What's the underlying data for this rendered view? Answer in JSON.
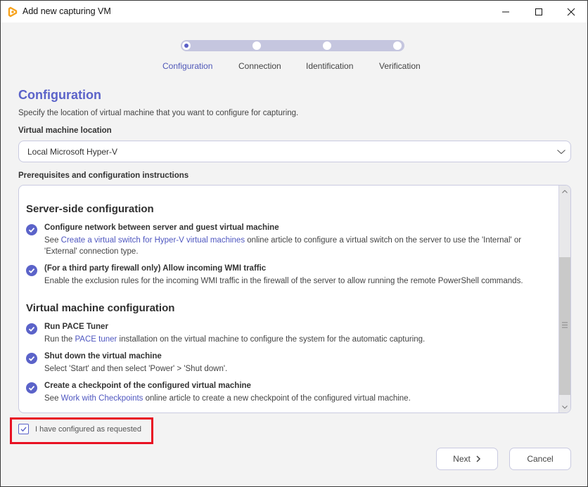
{
  "window": {
    "title": "Add new capturing VM",
    "controls": [
      "minimize",
      "maximize",
      "close"
    ]
  },
  "stepper": {
    "steps": [
      {
        "label": "Configuration",
        "active": true
      },
      {
        "label": "Connection",
        "active": false
      },
      {
        "label": "Identification",
        "active": false
      },
      {
        "label": "Verification",
        "active": false
      }
    ]
  },
  "page": {
    "title": "Configuration",
    "subtitle": "Specify the location of virtual machine that you want to configure for capturing."
  },
  "vm_location": {
    "label": "Virtual machine location",
    "selected": "Local Microsoft Hyper-V"
  },
  "instructions": {
    "label": "Prerequisites and configuration instructions",
    "sections": [
      {
        "title": "Server-side configuration",
        "items": [
          {
            "title": "Configure network between server and guest virtual machine",
            "desc_before": "See ",
            "link": "Create a virtual switch for Hyper-V virtual machines",
            "desc_after": " online article to configure a virtual switch on the server to use the 'Internal' or 'External' connection type."
          },
          {
            "title": "(For a third party firewall only) Allow incoming WMI traffic",
            "desc_before": "Enable the exclusion rules for the incoming WMI traffic in the firewall of the server to allow running the remote PowerShell commands.",
            "link": "",
            "desc_after": ""
          }
        ]
      },
      {
        "title": "Virtual machine configuration",
        "items": [
          {
            "title": "Run PACE Tuner",
            "desc_before": "Run the ",
            "link": "PACE tuner",
            "desc_after": " installation on the virtual machine to configure the system for the automatic capturing."
          },
          {
            "title": "Shut down the virtual machine",
            "desc_before": "Select 'Start' and then select 'Power' > 'Shut down'.",
            "link": "",
            "desc_after": ""
          },
          {
            "title": "Create a checkpoint of the configured virtual machine",
            "desc_before": "See ",
            "link": "Work with Checkpoints",
            "desc_after": " online article to create a new checkpoint of the configured virtual machine."
          }
        ]
      }
    ]
  },
  "confirm": {
    "label": "I have configured as requested",
    "checked": true
  },
  "buttons": {
    "next": "Next",
    "cancel": "Cancel"
  },
  "colors": {
    "accent": "#5b63c9",
    "link": "#4f57c0",
    "highlight": "#e81123",
    "app_icon": "#f7a21b"
  }
}
